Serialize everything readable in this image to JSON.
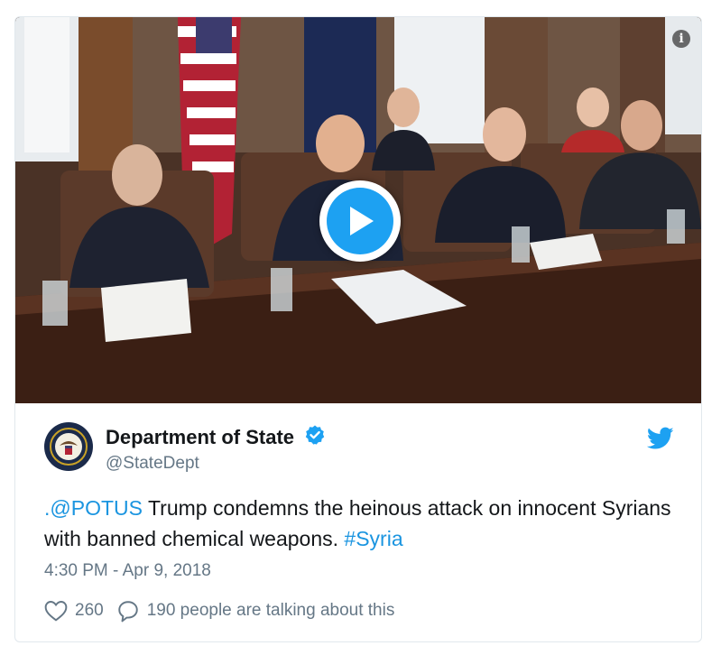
{
  "tweet": {
    "author": {
      "display_name": "Department of State",
      "handle": "@StateDept",
      "verified": true,
      "avatar_icon": "department-seal-icon"
    },
    "text": {
      "mention": ".@POTUS",
      "body_1": " Trump condemns the heinous attack on innocent Syrians with banned chemical weapons. ",
      "hashtag": "#Syria"
    },
    "timestamp": "4:30 PM - Apr 9, 2018",
    "likes": {
      "count": "260",
      "icon": "heart-icon"
    },
    "replies": {
      "label": "190 people are talking about this",
      "icon": "speech-bubble-icon"
    },
    "media": {
      "type": "video",
      "play_icon": "play-icon",
      "info_icon": "info-icon",
      "info_glyph": "i"
    }
  },
  "colors": {
    "link": "#1b95e0",
    "twitter_blue": "#1da1f2",
    "text_primary": "#14171a",
    "text_secondary": "#657786",
    "border": "#e1e8ed"
  },
  "brand_icon": "twitter-bird-icon"
}
